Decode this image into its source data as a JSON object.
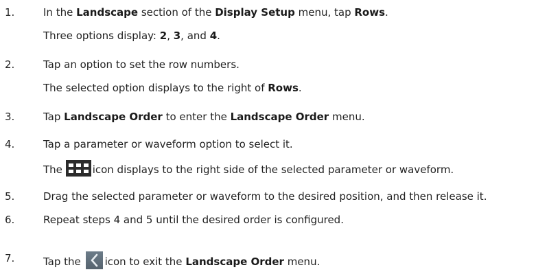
{
  "steps": [
    {
      "number": "1.",
      "text": [
        {
          "t": "In the ",
          "b": false
        },
        {
          "t": "Landscape",
          "b": true
        },
        {
          "t": " section of the ",
          "b": false
        },
        {
          "t": "Display Setup",
          "b": true
        },
        {
          "t": " menu, tap ",
          "b": false
        },
        {
          "t": "Rows",
          "b": true
        },
        {
          "t": ".",
          "b": false
        }
      ],
      "result": [
        {
          "t": "Three options display: ",
          "b": false
        },
        {
          "t": "2",
          "b": true
        },
        {
          "t": ", ",
          "b": false
        },
        {
          "t": "3",
          "b": true
        },
        {
          "t": ", and ",
          "b": false
        },
        {
          "t": "4",
          "b": true
        },
        {
          "t": ".",
          "b": false
        }
      ]
    },
    {
      "number": "2.",
      "text": [
        {
          "t": "Tap an option to set the row numbers.",
          "b": false
        }
      ],
      "result": [
        {
          "t": "The selected option displays to the right of ",
          "b": false
        },
        {
          "t": "Rows",
          "b": true
        },
        {
          "t": ".",
          "b": false
        }
      ]
    },
    {
      "number": "3.",
      "text": [
        {
          "t": "Tap ",
          "b": false
        },
        {
          "t": "Landscape Order",
          "b": true
        },
        {
          "t": " to enter the ",
          "b": false
        },
        {
          "t": "Landscape Order",
          "b": true
        },
        {
          "t": " menu.",
          "b": false
        }
      ]
    },
    {
      "number": "4.",
      "text": [
        {
          "t": "Tap a parameter or waveform option to select it.",
          "b": false
        }
      ],
      "result_before_icon": "The",
      "result_icon": "drag-grid-icon",
      "result_after_icon": "icon displays to the right side of the selected parameter or waveform."
    },
    {
      "number": "5.",
      "text": [
        {
          "t": "Drag the selected parameter or waveform to the desired position, and then release it.",
          "b": false
        }
      ]
    },
    {
      "number": "6.",
      "text": [
        {
          "t": "Repeat steps 4 and 5 until the desired order is configured.",
          "b": false
        }
      ]
    },
    {
      "number": "7.",
      "before_icon": "Tap the",
      "icon": "back-arrow-icon",
      "after_icon": [
        {
          "t": "icon to exit the ",
          "b": false
        },
        {
          "t": "Landscape Order",
          "b": true
        },
        {
          "t": " menu.",
          "b": false
        }
      ]
    }
  ]
}
